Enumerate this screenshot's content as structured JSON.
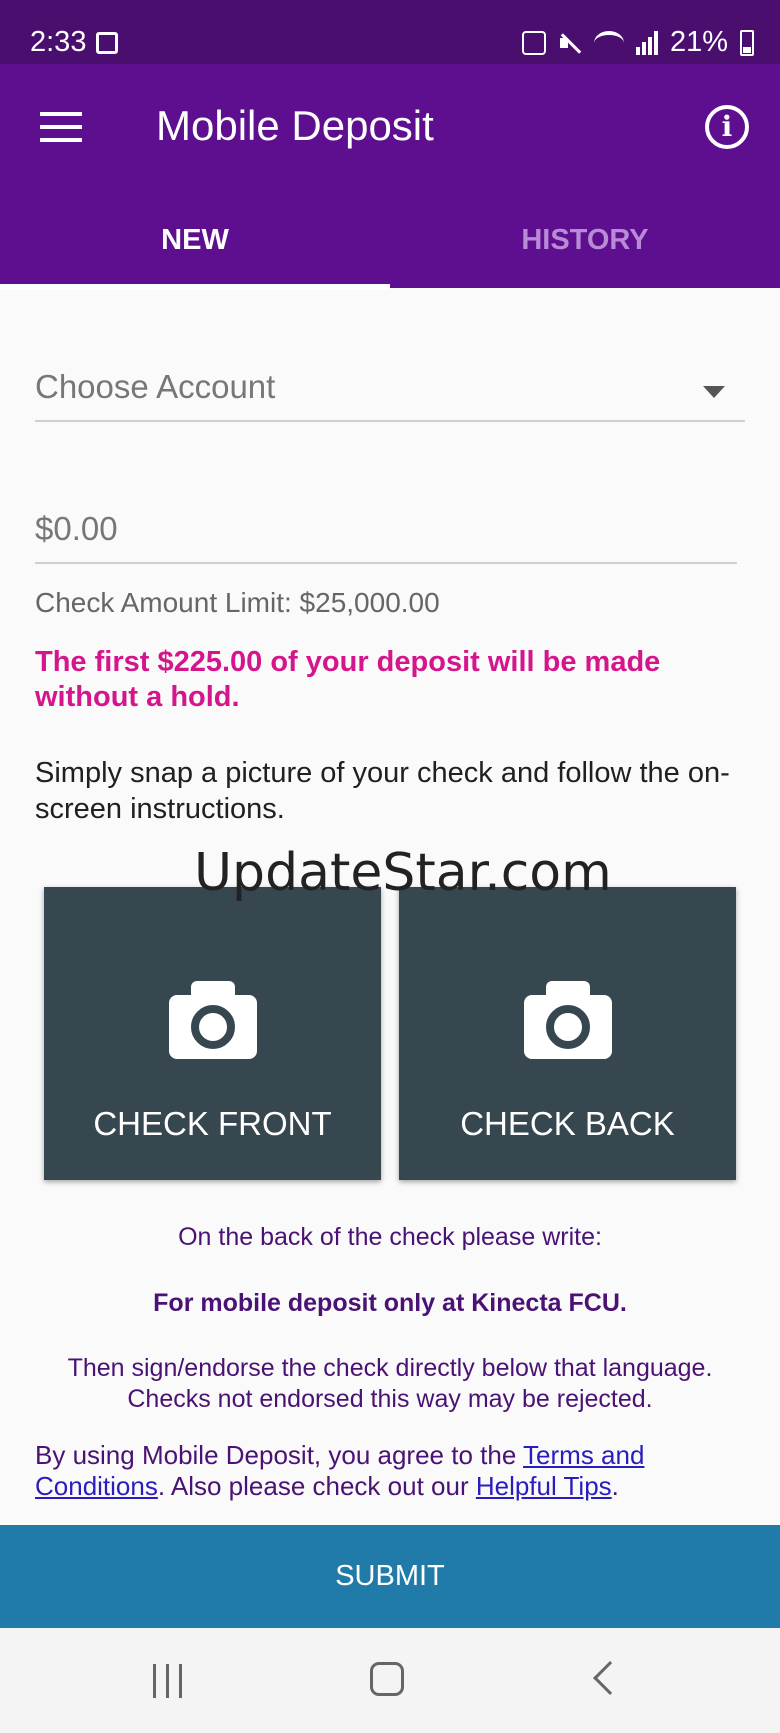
{
  "status_bar": {
    "time": "2:33",
    "battery": "21%"
  },
  "header": {
    "title": "Mobile Deposit"
  },
  "tabs": [
    {
      "label": "NEW"
    },
    {
      "label": "HISTORY"
    }
  ],
  "form": {
    "account_placeholder": "Choose Account",
    "amount_placeholder": "$0.00",
    "limit_text": "Check Amount Limit: $25,000.00",
    "hold_text": "The first $225.00 of your deposit will be made without a hold.",
    "snap_text": "Simply snap a picture of your check and follow the on-screen instructions."
  },
  "watermark": "UpdateStar.com",
  "capture": {
    "front_label": "CHECK FRONT",
    "back_label": "CHECK BACK"
  },
  "instructions": {
    "line1": "On the back of the check please write:",
    "line2": "For mobile deposit only at Kinecta FCU.",
    "line3a": "Then sign/endorse the check directly below that language.",
    "line3b": "Checks not endorsed this way may be rejected."
  },
  "terms": {
    "prefix": "By using Mobile Deposit, you agree to the ",
    "terms_link": "Terms and Conditions",
    "middle": ". Also please check out our ",
    "tips_link": "Helpful Tips",
    "suffix": "."
  },
  "submit_label": "SUBMIT",
  "colors": {
    "app_bar": "#5e0f8f",
    "status_bar": "#4a0f6e",
    "hold_text": "#d4158c",
    "capture_button": "#37474f",
    "submit": "#217ba9"
  }
}
